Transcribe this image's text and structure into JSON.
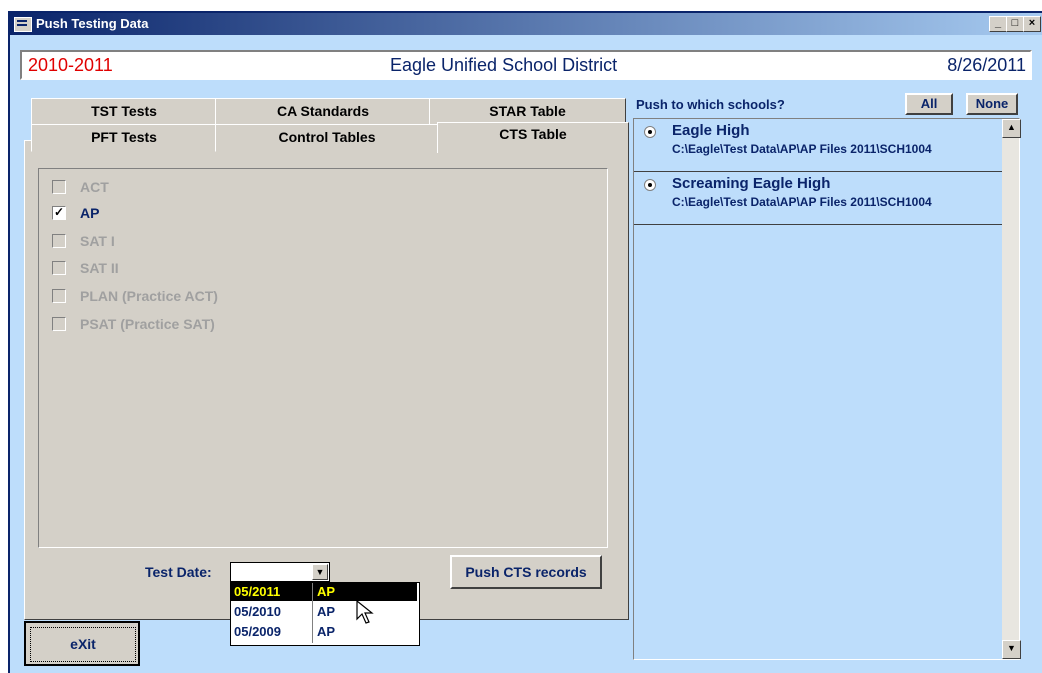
{
  "window": {
    "title": "Push Testing Data"
  },
  "header": {
    "year": "2010-2011",
    "district": "Eagle Unified School District",
    "date": "8/26/2011"
  },
  "tabs": {
    "row1": [
      "TST Tests",
      "CA Standards",
      "STAR Table"
    ],
    "row2": [
      "PFT Tests",
      "Control Tables",
      "CTS Table"
    ]
  },
  "checkboxes": [
    {
      "label": "ACT",
      "checked": false
    },
    {
      "label": "AP",
      "checked": true
    },
    {
      "label": "SAT I",
      "checked": false
    },
    {
      "label": "SAT II",
      "checked": false
    },
    {
      "label": "PLAN (Practice ACT)",
      "checked": false
    },
    {
      "label": "PSAT (Practice SAT)",
      "checked": false
    }
  ],
  "test_date": {
    "label": "Test Date:",
    "value": "",
    "options": [
      {
        "date": "05/2011",
        "type": "AP",
        "selected": true
      },
      {
        "date": "05/2010",
        "type": "AP",
        "selected": false
      },
      {
        "date": "05/2009",
        "type": "AP",
        "selected": false
      }
    ]
  },
  "buttons": {
    "push": "Push CTS records",
    "exit": "eXit",
    "all": "All",
    "none": "None"
  },
  "schools": {
    "label": "Push to which schools?",
    "items": [
      {
        "name": "Eagle High",
        "path": "C:\\Eagle\\Test Data\\AP\\AP Files 2011\\SCH1004"
      },
      {
        "name": "Screaming Eagle High",
        "path": "C:\\Eagle\\Test Data\\AP\\AP Files 2011\\SCH1004"
      }
    ]
  },
  "colors": {
    "accent": "#0a246a",
    "red": "#e00000",
    "background": "#bdddfb"
  }
}
